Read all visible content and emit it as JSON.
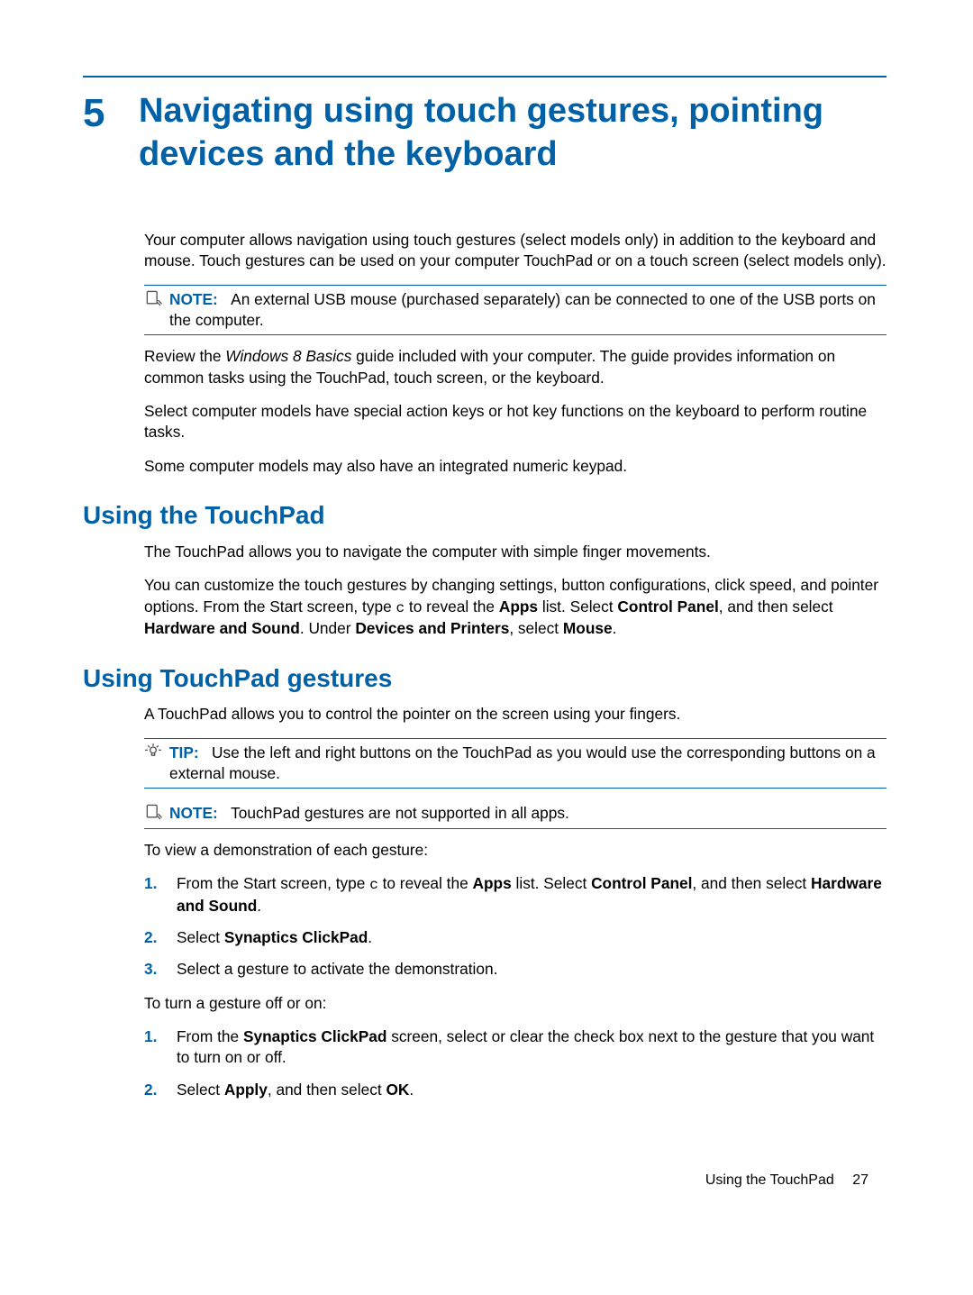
{
  "chapter": {
    "number": "5",
    "title": "Navigating using touch gestures, pointing devices and the keyboard"
  },
  "intro": {
    "p1": "Your computer allows navigation using touch gestures (select models only) in addition to the keyboard and mouse. Touch gestures can be used on your computer TouchPad or on a touch screen (select models only).",
    "note1_label": "NOTE:",
    "note1_text": "An external USB mouse (purchased separately) can be connected to one of the USB ports on the computer.",
    "p2_a": "Review the ",
    "p2_i": "Windows 8 Basics",
    "p2_b": " guide included with your computer. The guide provides information on common tasks using the TouchPad, touch screen, or the keyboard.",
    "p3": "Select computer models have special action keys or hot key functions on the keyboard to perform routine tasks.",
    "p4": "Some computer models may also have an integrated numeric keypad."
  },
  "sec1": {
    "heading": "Using the TouchPad",
    "p1": "The TouchPad allows you to navigate the computer with simple finger movements.",
    "p2_a": "You can customize the touch gestures by changing settings, button configurations, click speed, and pointer options. From the Start screen, type ",
    "p2_code": "c",
    "p2_b": " to reveal the ",
    "p2_bold1": "Apps",
    "p2_c": " list. Select ",
    "p2_bold2": "Control Panel",
    "p2_d": ", and then select ",
    "p2_bold3": "Hardware and Sound",
    "p2_e": ". Under ",
    "p2_bold4": "Devices and Printers",
    "p2_f": ", select ",
    "p2_bold5": "Mouse",
    "p2_g": "."
  },
  "sec2": {
    "heading": "Using TouchPad gestures",
    "p1": "A TouchPad allows you to control the pointer on the screen using your fingers.",
    "tip_label": "TIP:",
    "tip_text": "Use the left and right buttons on the TouchPad as you would use the corresponding buttons on a external mouse.",
    "note_label": "NOTE:",
    "note_text": "TouchPad gestures are not supported in all apps.",
    "p2": "To view a demonstration of each gesture:",
    "list1": {
      "n1": "1.",
      "i1_a": "From the Start screen, type ",
      "i1_code": "c",
      "i1_b": " to reveal the ",
      "i1_bold1": "Apps",
      "i1_c": " list. Select ",
      "i1_bold2": "Control Panel",
      "i1_d": ", and then select ",
      "i1_bold3": "Hardware and Sound",
      "i1_e": ".",
      "n2": "2.",
      "i2_a": "Select ",
      "i2_bold1": "Synaptics ClickPad",
      "i2_b": ".",
      "n3": "3.",
      "i3": "Select a gesture to activate the demonstration."
    },
    "p3": "To turn a gesture off or on:",
    "list2": {
      "n1": "1.",
      "i1_a": "From the ",
      "i1_bold1": "Synaptics ClickPad",
      "i1_b": " screen, select or clear the check box next to the gesture that you want to turn on or off.",
      "n2": "2.",
      "i2_a": "Select ",
      "i2_bold1": "Apply",
      "i2_b": ", and then select ",
      "i2_bold2": "OK",
      "i2_c": "."
    }
  },
  "footer": {
    "section": "Using the TouchPad",
    "page": "27"
  }
}
